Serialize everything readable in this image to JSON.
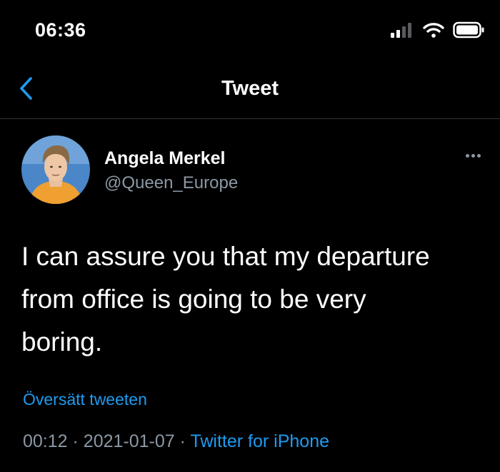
{
  "status_bar": {
    "time": "06:36"
  },
  "nav": {
    "title": "Tweet",
    "back_icon": "chevron-left-icon"
  },
  "author": {
    "name": "Angela Merkel",
    "handle": "@Queen_Europe"
  },
  "tweet": {
    "text_lines": [
      "I can assure you that my departure",
      "from office is going to be very",
      "boring."
    ],
    "translate_label": "Översätt tweeten",
    "time": "00:12",
    "separator": "·",
    "date": "2021-01-07",
    "source": "Twitter for iPhone"
  },
  "colors": {
    "background": "#000000",
    "accent": "#1d9bf0",
    "muted": "#8b98a5",
    "text": "#ffffff"
  }
}
